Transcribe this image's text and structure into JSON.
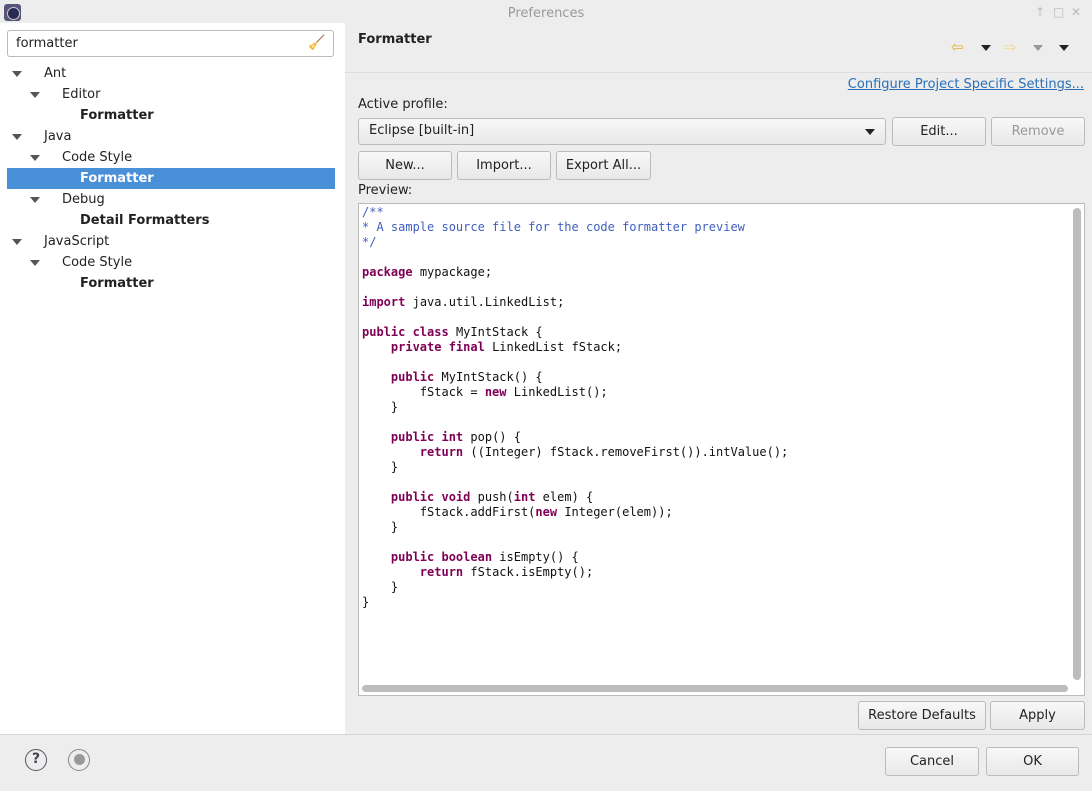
{
  "window": {
    "title": "Preferences"
  },
  "search": {
    "value": "formatter"
  },
  "tree": [
    {
      "label": "Ant",
      "level": 0,
      "expanded": true,
      "bold": false
    },
    {
      "label": "Editor",
      "level": 1,
      "expanded": true,
      "bold": false
    },
    {
      "label": "Formatter",
      "level": 2,
      "bold": true
    },
    {
      "label": "Java",
      "level": 0,
      "expanded": true,
      "bold": false
    },
    {
      "label": "Code Style",
      "level": 1,
      "expanded": true,
      "bold": false
    },
    {
      "label": "Formatter",
      "level": 2,
      "bold": true,
      "selected": true
    },
    {
      "label": "Debug",
      "level": 1,
      "expanded": true,
      "bold": false
    },
    {
      "label": "Detail Formatters",
      "level": 2,
      "bold": true
    },
    {
      "label": "JavaScript",
      "level": 0,
      "expanded": true,
      "bold": false
    },
    {
      "label": "Code Style",
      "level": 1,
      "expanded": true,
      "bold": false
    },
    {
      "label": "Formatter",
      "level": 2,
      "bold": true
    }
  ],
  "page": {
    "title": "Formatter",
    "link": "Configure Project Specific Settings...",
    "active_profile_label": "Active profile:",
    "profile": "Eclipse [built-in]",
    "edit": "Edit...",
    "remove": "Remove",
    "new": "New...",
    "import": "Import...",
    "export_all": "Export All...",
    "preview_label": "Preview:",
    "restore_defaults": "Restore Defaults",
    "apply": "Apply"
  },
  "dialog": {
    "cancel": "Cancel",
    "ok": "OK"
  },
  "colors": {
    "keyword": "#7f0055",
    "comment": "#3f5fbf",
    "selection": "#4a90d9",
    "link": "#2a6fb8"
  },
  "code": [
    [
      [
        "cm",
        "/**"
      ]
    ],
    [
      [
        "cm",
        "* A sample source file for the code formatter preview"
      ]
    ],
    [
      [
        "cm",
        "*/"
      ]
    ],
    [],
    [
      [
        "kw",
        "package"
      ],
      [
        "",
        "mypackage;"
      ]
    ],
    [],
    [
      [
        "kw",
        "import"
      ],
      [
        "",
        "java.util.LinkedList;"
      ]
    ],
    [],
    [
      [
        "kw",
        "public class"
      ],
      [
        "",
        "MyIntStack {"
      ]
    ],
    [
      [
        "",
        "    "
      ],
      [
        "kw",
        "private final"
      ],
      [
        "",
        "LinkedList fStack;"
      ]
    ],
    [],
    [
      [
        "",
        "    "
      ],
      [
        "kw",
        "public"
      ],
      [
        "",
        "MyIntStack() {"
      ]
    ],
    [
      [
        "",
        "        fStack = "
      ],
      [
        "kw",
        "new"
      ],
      [
        "",
        "LinkedList();"
      ]
    ],
    [
      [
        "",
        "    }"
      ]
    ],
    [],
    [
      [
        "",
        "    "
      ],
      [
        "kw",
        "public int"
      ],
      [
        "",
        "pop() {"
      ]
    ],
    [
      [
        "",
        "        "
      ],
      [
        "kw",
        "return"
      ],
      [
        "",
        "((Integer) fStack.removeFirst()).intValue();"
      ]
    ],
    [
      [
        "",
        "    }"
      ]
    ],
    [],
    [
      [
        "",
        "    "
      ],
      [
        "kw",
        "public void"
      ],
      [
        "",
        "push("
      ],
      [
        "kw",
        "int"
      ],
      [
        "",
        "elem) {"
      ]
    ],
    [
      [
        "",
        "        fStack.addFirst("
      ],
      [
        "kw",
        "new"
      ],
      [
        "",
        "Integer(elem));"
      ]
    ],
    [
      [
        "",
        "    }"
      ]
    ],
    [],
    [
      [
        "",
        "    "
      ],
      [
        "kw",
        "public boolean"
      ],
      [
        "",
        "isEmpty() {"
      ]
    ],
    [
      [
        "",
        "        "
      ],
      [
        "kw",
        "return"
      ],
      [
        "",
        "fStack.isEmpty();"
      ]
    ],
    [
      [
        "",
        "    }"
      ]
    ],
    [
      [
        "",
        "}"
      ]
    ]
  ]
}
